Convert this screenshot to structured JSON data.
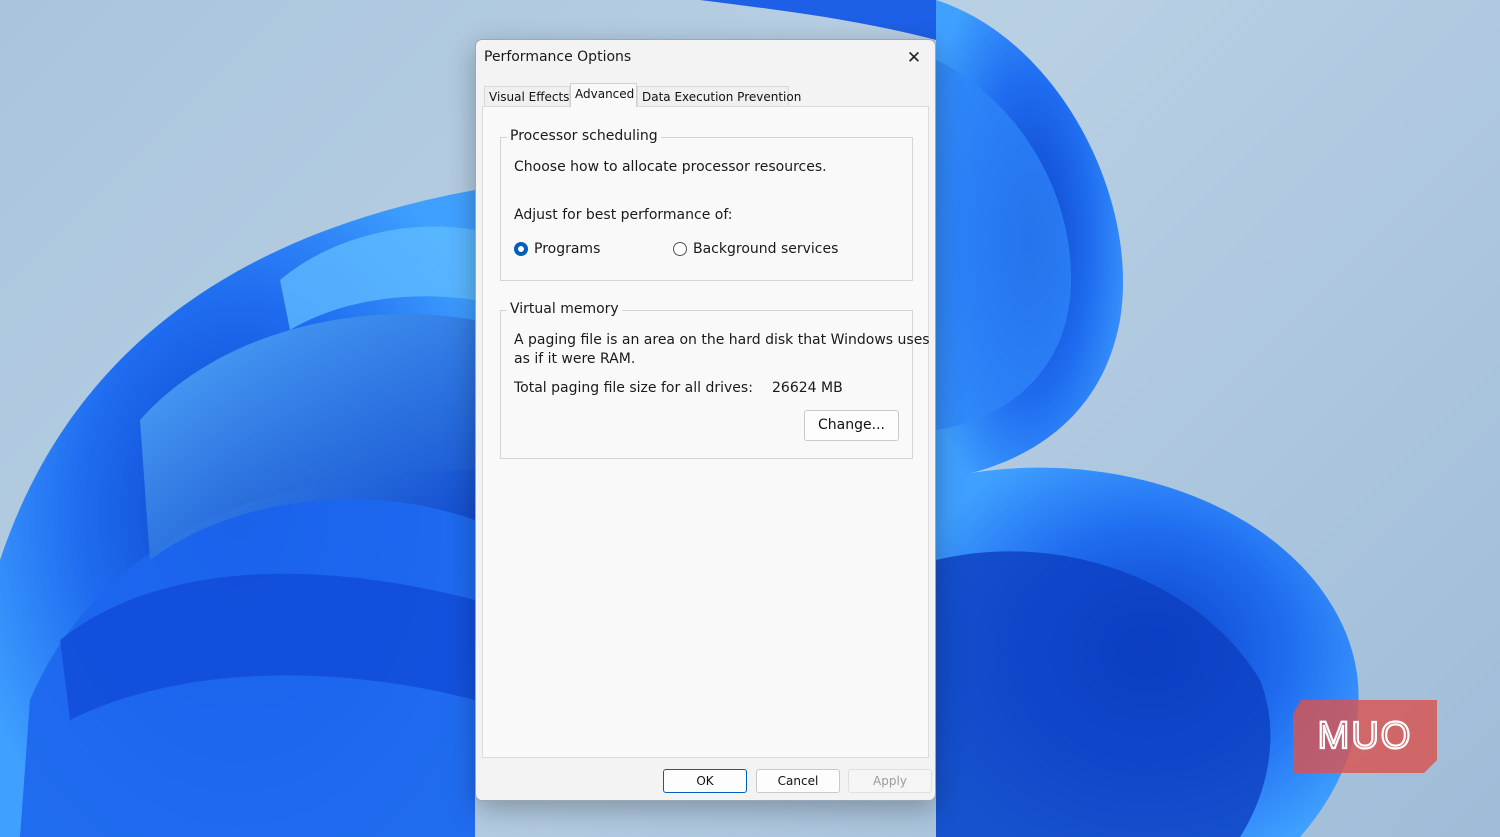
{
  "dialog": {
    "title": "Performance Options",
    "close_icon": "close-icon",
    "tabs": [
      {
        "label": "Visual Effects",
        "active": false
      },
      {
        "label": "Advanced",
        "active": true
      },
      {
        "label": "Data Execution Prevention",
        "active": false
      }
    ],
    "processor": {
      "legend": "Processor scheduling",
      "description": "Choose how to allocate processor resources.",
      "adjust_label": "Adjust for best performance of:",
      "options": [
        {
          "label": "Programs",
          "selected": true
        },
        {
          "label": "Background services",
          "selected": false
        }
      ]
    },
    "virtual_memory": {
      "legend": "Virtual memory",
      "description_line1": "A paging file is an area on the hard disk that Windows uses",
      "description_line2": "as if it were RAM.",
      "total_label": "Total paging file size for all drives:",
      "total_value": "26624 MB",
      "change_button": "Change..."
    },
    "buttons": {
      "ok": "OK",
      "cancel": "Cancel",
      "apply": "Apply"
    }
  },
  "watermark": {
    "text": "MUO",
    "color": "#d9534f"
  },
  "colors": {
    "accent": "#005fb8",
    "wallpaper_blue": "#1a5fe0"
  }
}
